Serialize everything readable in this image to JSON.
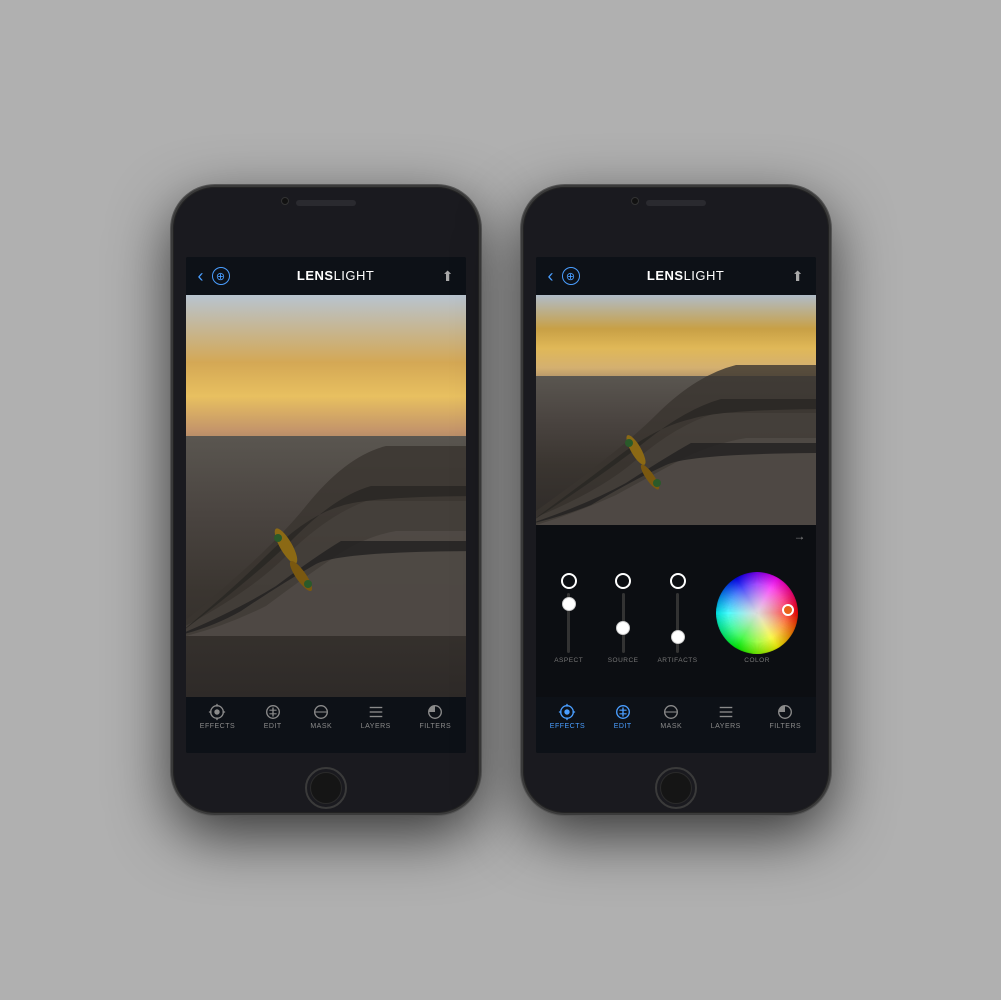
{
  "background_color": "#b0b0b0",
  "phones": [
    {
      "id": "phone-left",
      "header": {
        "back_label": "‹",
        "zoom_label": "⊕",
        "title_bold": "LENS",
        "title_light": "LIGHT",
        "share_label": "⬆"
      },
      "tabs": [
        {
          "id": "effects",
          "label": "EFFECTS",
          "active": false
        },
        {
          "id": "edit",
          "label": "EDIT",
          "active": false
        },
        {
          "id": "mask",
          "label": "MASK",
          "active": false
        },
        {
          "id": "layers",
          "label": "LAYERS",
          "active": false
        },
        {
          "id": "filters",
          "label": "FILTERS",
          "active": false
        }
      ]
    },
    {
      "id": "phone-right",
      "header": {
        "back_label": "‹",
        "zoom_label": "⊕",
        "title_bold": "LENS",
        "title_light": "LIGHT",
        "share_label": "⬆"
      },
      "controls": {
        "arrow": "→",
        "sliders": [
          {
            "id": "aspect",
            "label": "ASPECT",
            "thumb_pos": 0.15
          },
          {
            "id": "source",
            "label": "SOURCE",
            "thumb_pos": 0.5
          },
          {
            "id": "artifacts",
            "label": "ARTIFACTS",
            "thumb_pos": 0.65
          }
        ],
        "color_wheel": {
          "label": "COLOR",
          "dot_color": "#e8621a"
        }
      },
      "tabs": [
        {
          "id": "effects",
          "label": "EFFECTS",
          "active": true
        },
        {
          "id": "edit",
          "label": "EDIT",
          "active": true
        },
        {
          "id": "mask",
          "label": "MASK",
          "active": false
        },
        {
          "id": "layers",
          "label": "LAYERS",
          "active": false
        },
        {
          "id": "filters",
          "label": "FILTERS",
          "active": false
        }
      ]
    }
  ]
}
